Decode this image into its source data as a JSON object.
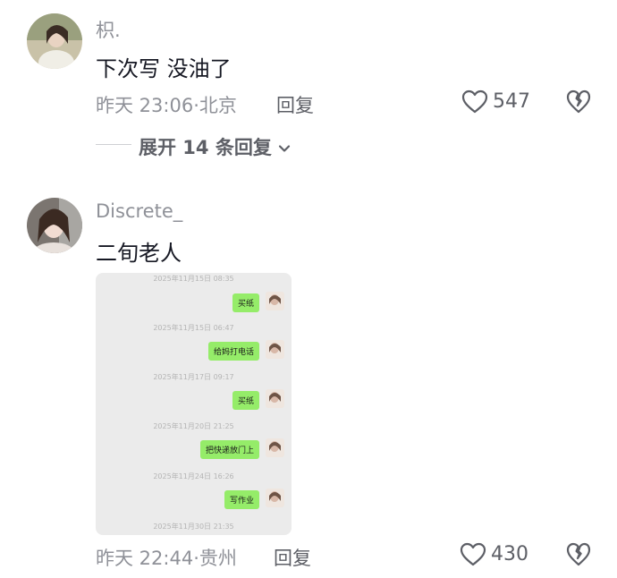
{
  "comments": [
    {
      "username": "枳.",
      "content": "下次写 没油了",
      "time": "昨天 23:06",
      "location": "北京",
      "reply_label": "回复",
      "likes": "547",
      "expand_label": "展开 14 条回复"
    },
    {
      "username": "Discrete_",
      "content": "二旬老人",
      "time": "昨天 22:44",
      "location": "贵州",
      "reply_label": "回复",
      "likes": "430",
      "chat_screenshot": {
        "messages": [
          {
            "timestamp": "2025年11月15日 08:35",
            "text": "买纸"
          },
          {
            "timestamp": "2025年11月15日 06:47",
            "text": "给妈打电话"
          },
          {
            "timestamp": "2025年11月17日 09:17",
            "text": "买纸"
          },
          {
            "timestamp": "2025年11月20日 21:25",
            "text": "把快递放门上"
          },
          {
            "timestamp": "2025年11月24日 16:26",
            "text": "写作业"
          }
        ],
        "trailing_timestamp": "2025年11月30日 21:35"
      }
    }
  ],
  "colors": {
    "muted_text": "#8f9198",
    "chat_bubble": "#95ec69",
    "chat_bg": "#ebebeb"
  },
  "icons": [
    "avatar-photo",
    "heart-outline-icon",
    "broken-heart-icon",
    "chevron-down-icon"
  ]
}
